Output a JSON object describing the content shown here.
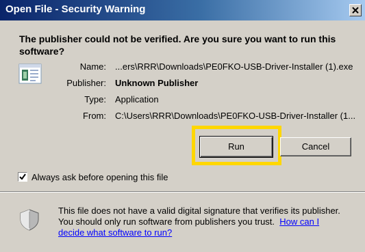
{
  "window": {
    "title": "Open File - Security Warning",
    "close_label": "X"
  },
  "headline": "The publisher could not be verified.  Are you sure you want to run this software?",
  "details": {
    "name_label": "Name:",
    "name_value": "...ers\\RRR\\Downloads\\PE0FKO-USB-Driver-Installer (1).exe",
    "publisher_label": "Publisher:",
    "publisher_value": "Unknown Publisher",
    "type_label": "Type:",
    "type_value": "Application",
    "from_label": "From:",
    "from_value": "C:\\Users\\RRR\\Downloads\\PE0FKO-USB-Driver-Installer (1..."
  },
  "buttons": {
    "run_label": "Run",
    "cancel_label": "Cancel"
  },
  "checkbox": {
    "label": "Always ask before opening this file",
    "checked": true
  },
  "warning": {
    "text": "This file does not have a valid digital signature that verifies its publisher. You should only software from publishers you trust.",
    "text_line1": "This file does not have a valid digital signature that verifies its publisher.",
    "text_line2": "You should only run software from publishers you trust.",
    "link_part1": "How can I",
    "link_part2": "decide what software to run?"
  },
  "colors": {
    "highlight": "#ffd700",
    "titlebar": "#0a246a",
    "link": "#0000ff"
  },
  "icons": [
    "file-icon",
    "shield-icon",
    "close-icon",
    "checkmark-icon"
  ]
}
